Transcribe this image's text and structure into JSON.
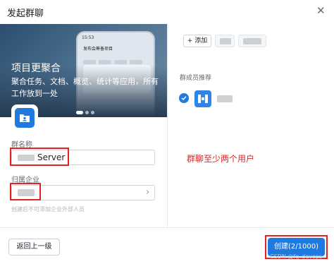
{
  "dialog": {
    "title": "发起群聊",
    "close_icon": "close-icon"
  },
  "banner": {
    "title": "项目更聚合",
    "description": "聚合任务、文档、概览、统计等应用，所有工作放到一处",
    "phone_time": "15:53",
    "phone_heading": "发布会筹备项目",
    "slide_count": 3,
    "active_slide": 1
  },
  "form": {
    "group_name_label": "群名称",
    "group_name_value": "Server",
    "org_label": "归属企业",
    "hint": "创建后不可添加企业外部人员"
  },
  "members": {
    "add_label": "+ 添加",
    "recommend_label": "群成员推荐"
  },
  "annotation": {
    "text": "群聊至少两个用户"
  },
  "footer": {
    "back_label": "返回上一级",
    "create_label": "创建(2/1000)",
    "watermark": "CSDN @fq_devops"
  },
  "colors": {
    "accent": "#1f7ae0",
    "annotation_red": "#e02424"
  }
}
